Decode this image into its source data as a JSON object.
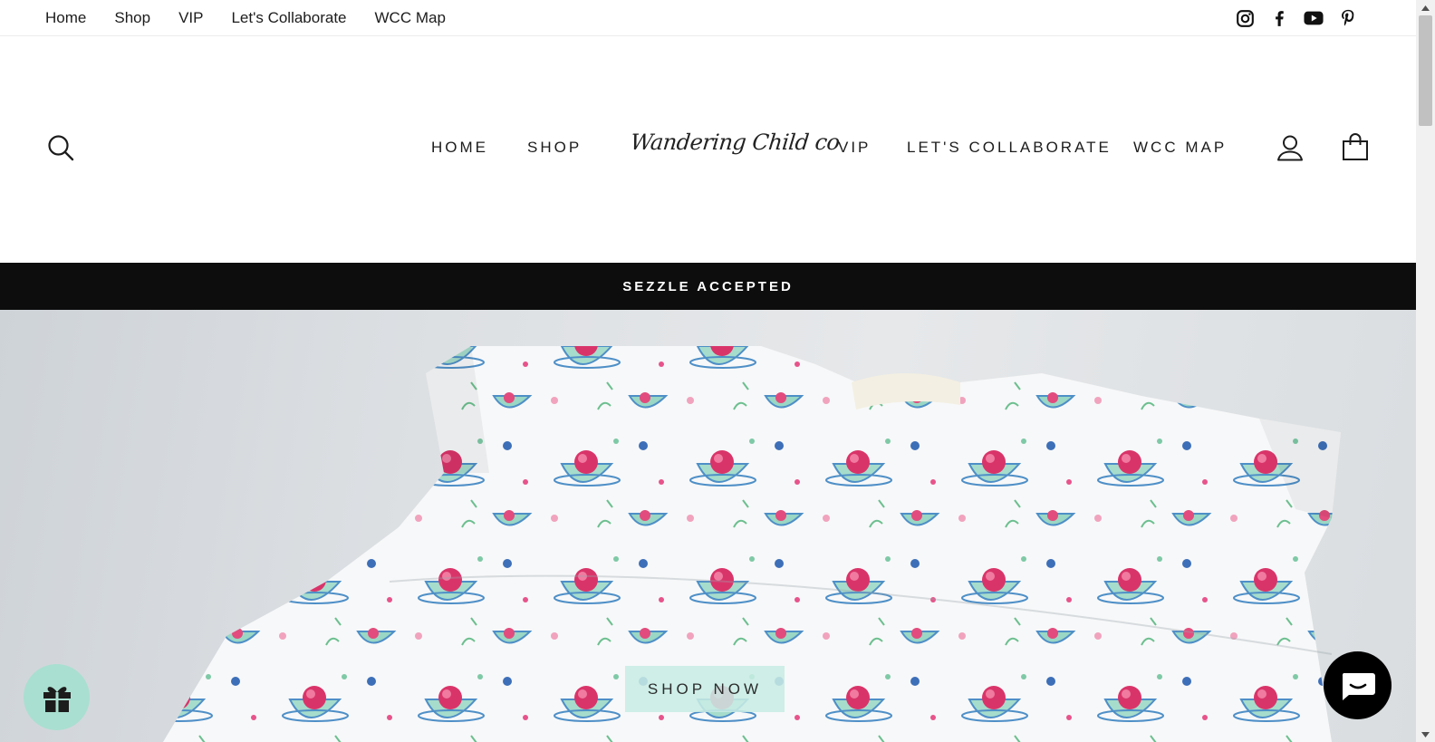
{
  "topbar": {
    "links": [
      "Home",
      "Shop",
      "VIP",
      "Let's Collaborate",
      "WCC Map"
    ],
    "social": [
      "instagram-icon",
      "facebook-icon",
      "youtube-icon",
      "pinterest-icon"
    ]
  },
  "header": {
    "logo": "Wandering Child co",
    "nav_left": [
      "HOME",
      "SHOP"
    ],
    "nav_right": [
      "VIP",
      "LET'S COLLABORATE",
      "WCC MAP"
    ],
    "icons": [
      "search-icon",
      "account-icon",
      "cart-icon"
    ]
  },
  "announcement": {
    "text": "SEZZLE ACCEPTED"
  },
  "hero": {
    "button_label": "SHOP NOW"
  },
  "widgets": {
    "gift": "gift-icon",
    "chat": "chat-icon"
  },
  "colors": {
    "announcement_bg": "#0d0d0d",
    "button_bg": "#c8ece4",
    "gift_bg": "#a9dfd0",
    "chat_bg": "#000000"
  }
}
